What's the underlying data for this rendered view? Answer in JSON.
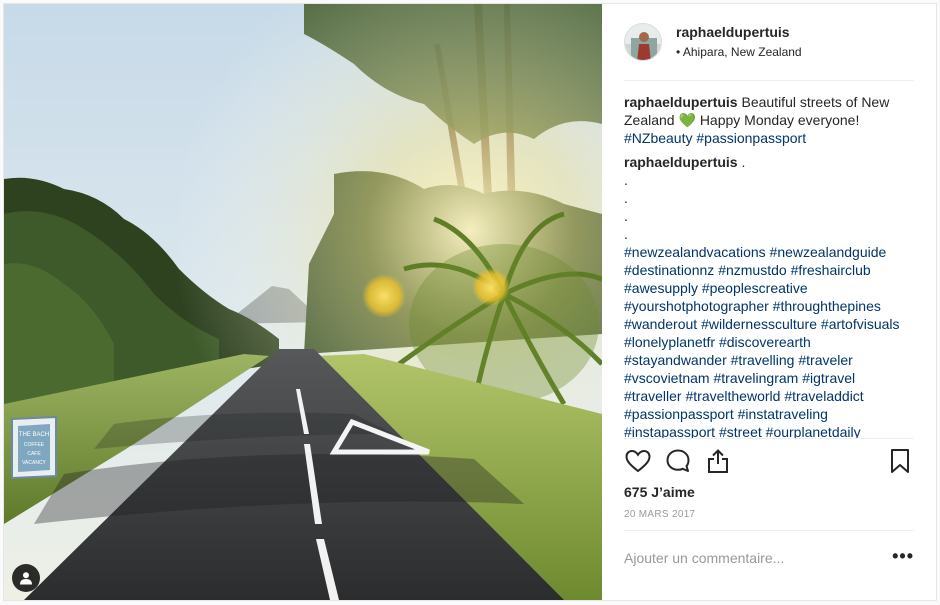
{
  "post": {
    "author": "raphaeldupertuis",
    "location": "Ahipara, New Zealand",
    "caption": {
      "user": "raphaeldupertuis",
      "text_before": "Beautiful streets of New Zealand",
      "emoji": "💚",
      "text_after": "Happy Monday everyone!",
      "hashtags": [
        "#NZbeauty",
        "#passionpassport"
      ]
    },
    "comment": {
      "user": "raphaeldupertuis",
      "first_line": ".",
      "dot_lines": [
        ".",
        ".",
        ".",
        "."
      ],
      "hashtags": [
        "#newzealandvacations",
        "#newzealandguide",
        "#destinationnz",
        "#nzmustdo",
        "#freshairclub",
        "#awesupply",
        "#peoplescreative",
        "#yourshotphotographer",
        "#throughthepines",
        "#wanderout",
        "#wildernessculture",
        "#artofvisuals",
        "#lonelyplanetfr",
        "#discoverearth",
        "#stayandwander",
        "#travelling",
        "#traveler",
        "#vscovietnam",
        "#travelingram",
        "#igtravel",
        "#traveller",
        "#traveltheworld",
        "#traveladdict",
        "#passionpassport",
        "#instatraveling",
        "#instapassport",
        "#street",
        "#ourplanetdaily"
      ]
    },
    "likes": "675 J’aime",
    "date": "20 MARS 2017",
    "add_comment_placeholder": "Ajouter un commentaire...",
    "more_label": "•••",
    "sign_text": [
      "THE BACH",
      "COFFEE",
      "CAFE",
      "VACANCY"
    ]
  },
  "icons": {
    "like": "heart-outline-icon",
    "comment": "speech-bubble-icon",
    "share": "share-upload-icon",
    "save": "bookmark-icon",
    "tag": "user-tag-icon",
    "more": "ellipsis-icon"
  },
  "colors": {
    "hashtag": "#003569",
    "text": "#262626",
    "muted": "#999999",
    "divider": "#efefef",
    "emoji_heart": "#32c832"
  }
}
